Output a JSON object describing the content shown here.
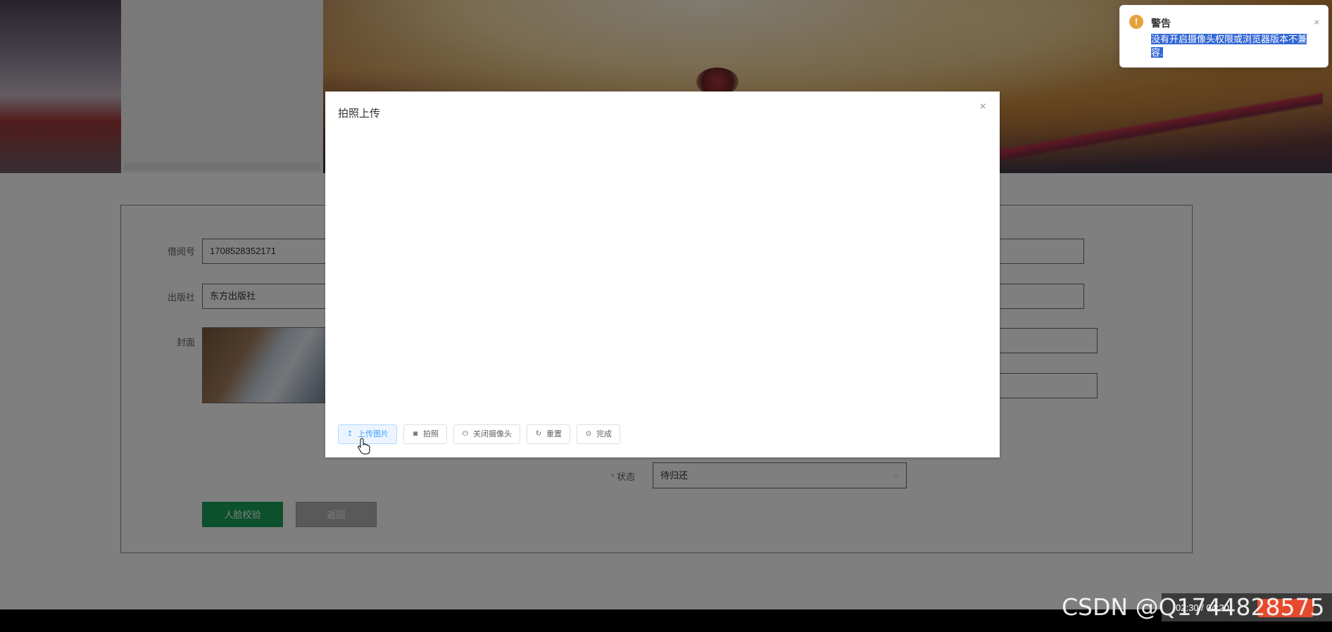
{
  "form": {
    "borrow_no_label": "借阅号",
    "borrow_no_value": "1708528352171",
    "publisher_label": "出版社",
    "publisher_value": "东方出版社",
    "cover_label": "封面",
    "status_label": "状态",
    "status_value": "待归还",
    "face_check_button": "人脸校验",
    "back_button": "返回"
  },
  "dialog": {
    "title": "拍照上传",
    "close": "×",
    "buttons": [
      {
        "label": "上传图片",
        "icon": "upload-icon"
      },
      {
        "label": "拍照",
        "icon": "camera-icon"
      },
      {
        "label": "关闭摄像头",
        "icon": "power-icon"
      },
      {
        "label": "重置",
        "icon": "refresh-icon"
      },
      {
        "label": "完成",
        "icon": "check-circle-icon"
      }
    ]
  },
  "notification": {
    "title": "警告",
    "message": "没有开启摄像头权限或浏览器版本不兼容.",
    "icon": "warning-icon",
    "close": "×"
  },
  "video": {
    "time": "02:30 / 04:20"
  },
  "watermark": "CSDN @Q1744828575",
  "colors": {
    "primary": "#409eff",
    "success": "#18a058",
    "warning": "#e6a23c",
    "selection": "#3367d6"
  }
}
